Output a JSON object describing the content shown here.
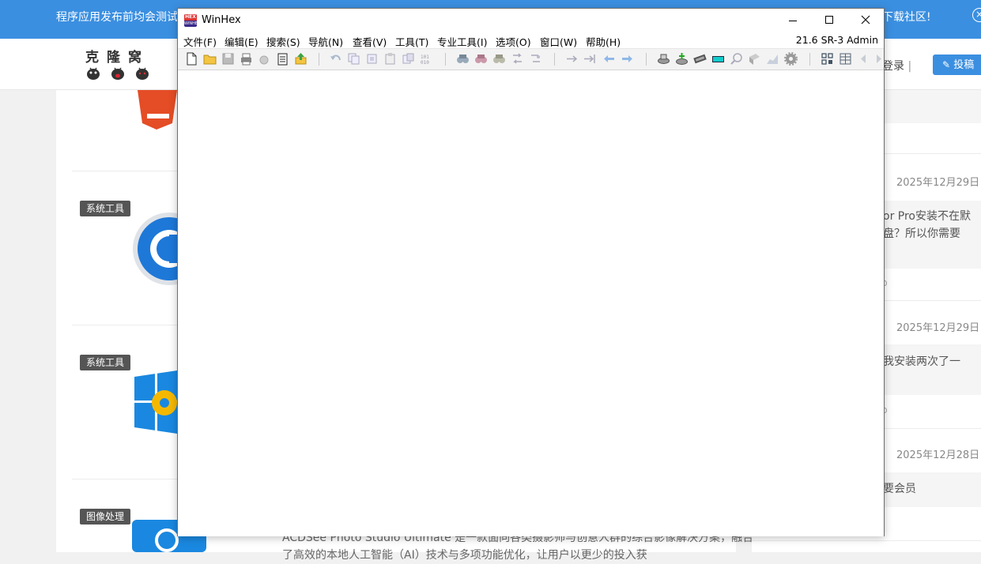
{
  "website": {
    "announcement_left": "程序应用发布前均会测试",
    "announcement_right": "下载社区!",
    "close_glyph": "×",
    "logo_text": "克隆窝",
    "login": "登录",
    "login_sep": "|",
    "post_button": "投稿",
    "tags": [
      "系统工具",
      "系统工具",
      "图像处理"
    ],
    "article_desc_line1": "ACDSee Photo Studio Ultimate 是一款面向各类摄影师与创意人群的综合影像解决方案，融合",
    "article_desc_line2": "了高效的本地人工智能（AI）技术与多项功能优化，让用户以更少的投入获",
    "sidebar": {
      "items": [
        {
          "date": "2025年12月29日",
          "text_line1": "or Pro安装不在默",
          "text_line2": "盘？所以你需要",
          "p": "p"
        },
        {
          "date": "2025年12月29日",
          "text_line1": "我安装两次了一",
          "text_line2": "",
          "p": "p"
        },
        {
          "date": "2025年12月28日",
          "text_line1": "要会员",
          "text_line2": "",
          "p": ""
        }
      ]
    }
  },
  "winhex": {
    "title": "WinHex",
    "icon_top": "HEX",
    "icon_bottom": "WINHEX",
    "menu": [
      "文件(F)",
      "编辑(E)",
      "搜索(S)",
      "导航(N)",
      "查看(V)",
      "工具(T)",
      "专业工具(I)",
      "选项(O)",
      "窗口(W)",
      "帮助(H)"
    ],
    "version": "21.6 SR-3 Admin",
    "toolbar_icons": [
      "new-file-icon",
      "open-folder-icon",
      "save-icon",
      "print-icon",
      "undo-save-icon",
      "properties-icon",
      "export-icon",
      "undo-icon",
      "copy-icon",
      "cut-icon",
      "paste-icon",
      "paste-special-icon",
      "binary-icon",
      "find-icon",
      "find-hex-icon",
      "find-text-icon",
      "replace-icon",
      "replace-hex-icon",
      "goto-offset-icon",
      "goto-sector-icon",
      "back-icon",
      "forward-icon",
      "open-disk-icon",
      "add-disk-icon",
      "ram-icon",
      "calculator-icon",
      "zoom-icon",
      "analyze-icon",
      "chart-icon",
      "settings-icon",
      "grid-icon",
      "layout-icon",
      "prev-icon",
      "next-icon"
    ],
    "accent": "#3b8fe0"
  }
}
